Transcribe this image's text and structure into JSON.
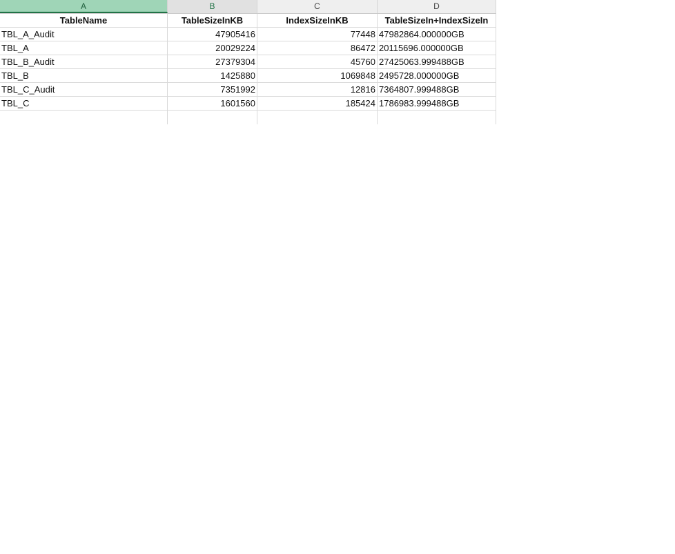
{
  "columns": [
    "A",
    "B",
    "C",
    "D"
  ],
  "header": [
    "TableName",
    "TableSizeInKB",
    "IndexSizeInKB",
    "TableSizeIn+IndexSizeIn"
  ],
  "rows": [
    [
      "TBL_A_Audit",
      "47905416",
      "77448",
      "47982864.000000GB"
    ],
    [
      "TBL_A",
      "20029224",
      "86472",
      "20115696.000000GB"
    ],
    [
      "TBL_B_Audit",
      "27379304",
      "45760",
      "27425063.999488GB"
    ],
    [
      "TBL_B",
      "1425880",
      "1069848",
      "2495728.000000GB"
    ],
    [
      "TBL_C_Audit",
      "7351992",
      "12816",
      "7364807.999488GB"
    ],
    [
      "TBL_C",
      "1601560",
      "185424",
      "1786983.999488GB"
    ]
  ]
}
